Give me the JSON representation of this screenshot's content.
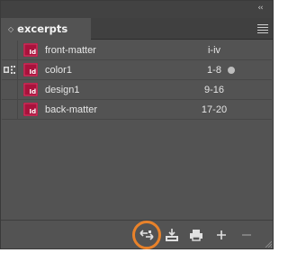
{
  "panel": {
    "collapse_glyph": "‹‹",
    "tab": {
      "label": "excerpts",
      "arrow": "◇"
    }
  },
  "documents": [
    {
      "name": "front-matter",
      "pages": "i-iv",
      "status": "",
      "modified": false
    },
    {
      "name": "color1",
      "pages": "1-8",
      "status": "style-source-icon",
      "modified": true
    },
    {
      "name": "design1",
      "pages": "9-16",
      "status": "",
      "modified": false
    },
    {
      "name": "back-matter",
      "pages": "17-20",
      "status": "",
      "modified": false
    }
  ],
  "doc_icon": {
    "name": "indesign-document-icon",
    "label": "Id",
    "color": "#a9123c"
  },
  "footer": {
    "buttons": [
      {
        "name": "synchronize-styles-icon"
      },
      {
        "name": "save-book-icon"
      },
      {
        "name": "print-book-icon"
      },
      {
        "name": "add-document-icon"
      },
      {
        "name": "remove-document-icon"
      }
    ],
    "highlight_color": "#e8822a"
  }
}
